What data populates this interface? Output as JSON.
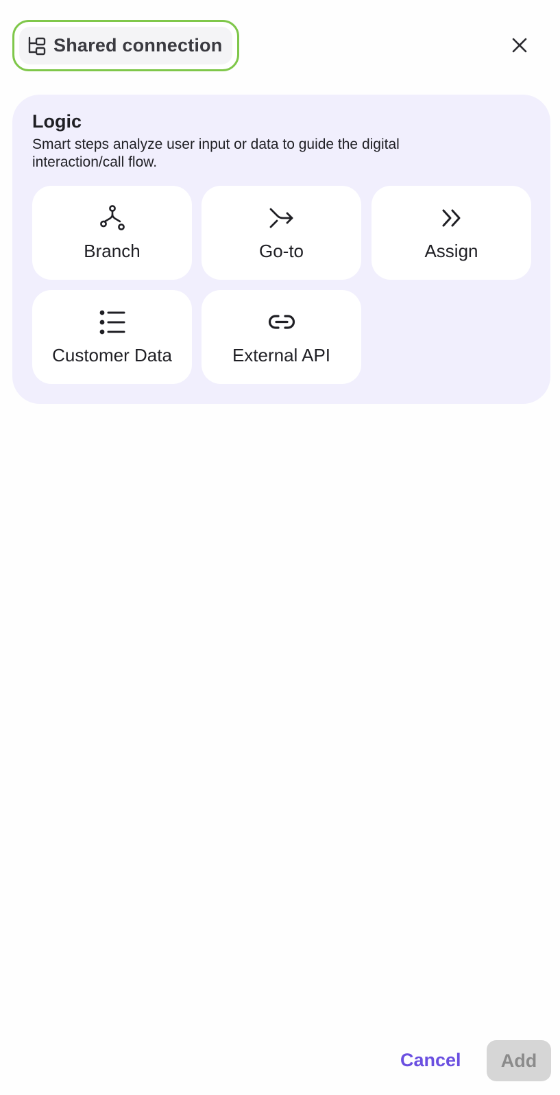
{
  "header": {
    "chip_label": "Shared connection",
    "chip_icon": "hierarchy-icon",
    "chip_border_color": "#7fc74a",
    "close_icon": "close-icon"
  },
  "logic_section": {
    "title": "Logic",
    "description": "Smart steps analyze user input or data to guide the digital interaction/call flow.",
    "background_color": "#f1effd",
    "items": [
      {
        "label": "Branch",
        "icon": "branch-icon"
      },
      {
        "label": "Go-to",
        "icon": "goto-arrow-icon"
      },
      {
        "label": "Assign",
        "icon": "double-chevron-right-icon"
      },
      {
        "label": "Customer Data",
        "icon": "list-icon"
      },
      {
        "label": "External API",
        "icon": "link-icon"
      }
    ]
  },
  "footer": {
    "cancel_label": "Cancel",
    "add_label": "Add",
    "accent_color": "#6a4fe0",
    "add_disabled": true
  }
}
